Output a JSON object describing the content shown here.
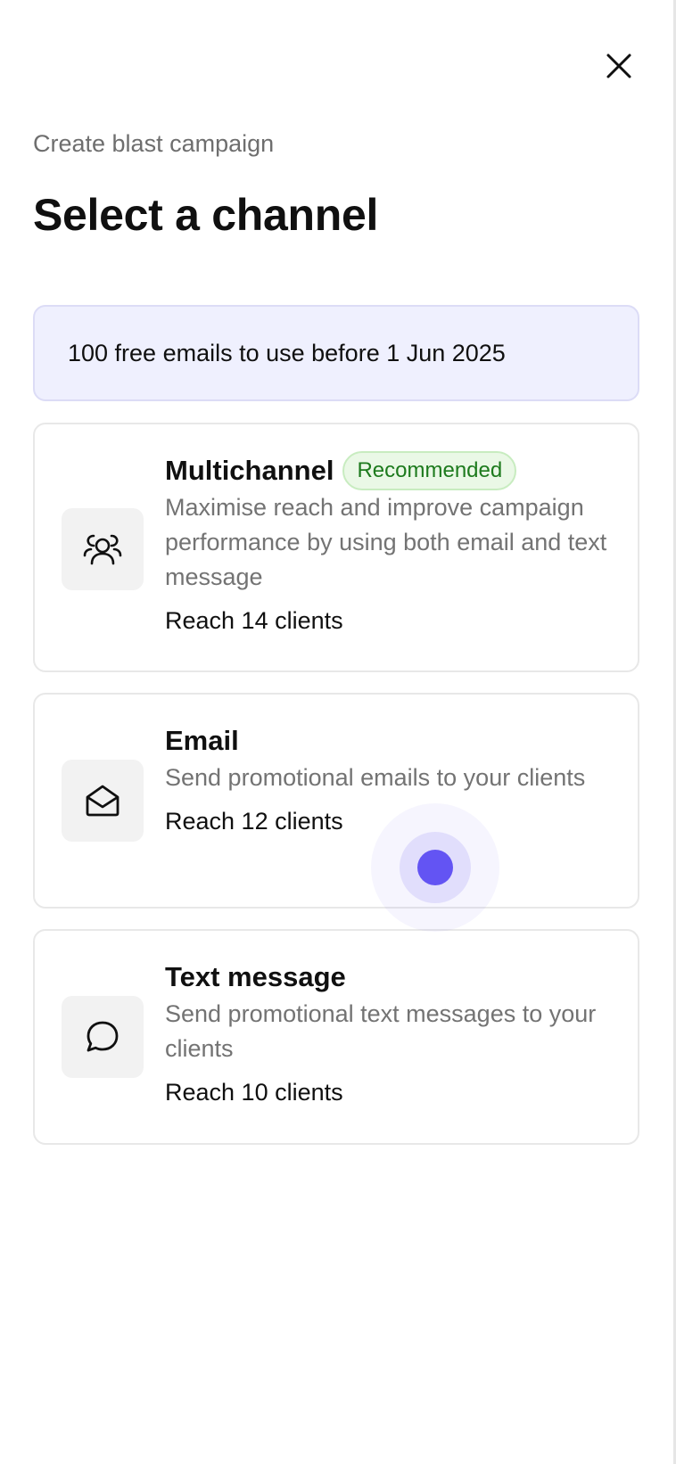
{
  "header": {
    "subtitle": "Create blast campaign",
    "title": "Select a channel",
    "close_icon": "close-icon"
  },
  "banner": {
    "text": "100 free emails to use before 1 Jun 2025"
  },
  "channels": [
    {
      "icon": "users-icon",
      "title": "Multichannel",
      "badge": "Recommended",
      "description": "Maximise reach and improve campaign performance by using both email and text message",
      "reach": "Reach 14 clients"
    },
    {
      "icon": "envelope-open-icon",
      "title": "Email",
      "description": "Send promotional emails to your clients",
      "reach": "Reach 12 clients"
    },
    {
      "icon": "chat-bubble-icon",
      "title": "Text message",
      "description": "Send promotional text messages to your clients",
      "reach": "Reach 10 clients"
    }
  ],
  "colors": {
    "banner_bg": "#eff0fe",
    "badge_text": "#1d7a1d",
    "touch_indicator": "#6354f3"
  }
}
